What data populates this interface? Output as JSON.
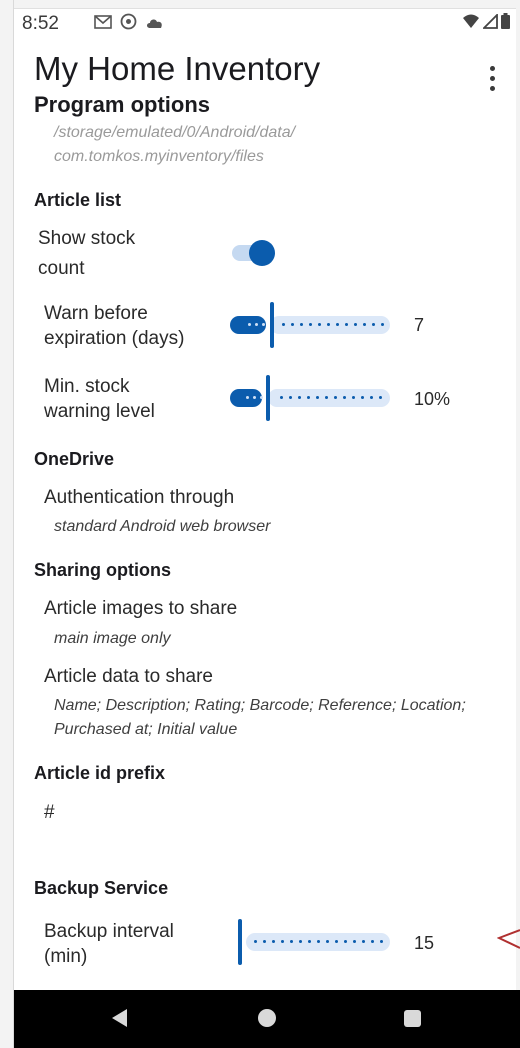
{
  "status_bar": {
    "time": "8:52",
    "left_icons": [
      "gmail-icon",
      "sync-icon",
      "cloud-icon"
    ],
    "right_icons": [
      "wifi-icon",
      "signal-icon",
      "battery-icon"
    ]
  },
  "app_bar": {
    "title": "My Home Inventory",
    "menu_icon": "overflow-menu-icon"
  },
  "program_options": {
    "heading": "Program options",
    "path_line1": "/storage/emulated/0/Android/data/",
    "path_line2": "com.tomkos.myinventory/files"
  },
  "article_list": {
    "heading": "Article list",
    "show_stock": {
      "label_line1": "Show stock",
      "label_line2": "count",
      "checked": true
    },
    "warn_expiration": {
      "label_line1": "Warn before",
      "label_line2": "expiration (days)",
      "value": "7"
    },
    "min_stock": {
      "label_line1": "Min. stock",
      "label_line2": "warning level",
      "value": "10%"
    }
  },
  "onedrive": {
    "heading": "OneDrive",
    "auth_title": "Authentication through",
    "auth_value": "standard Android web browser"
  },
  "sharing": {
    "heading": "Sharing options",
    "images_title": "Article images to share",
    "images_value": "main image only",
    "data_title": "Article data to share",
    "data_value_line1": "Name; Description; Rating; Barcode; Reference; Location;",
    "data_value_line2": "Purchased at; Initial value"
  },
  "article_id": {
    "heading": "Article id prefix",
    "value": "#"
  },
  "backup": {
    "heading": "Backup Service",
    "interval_label_line1": "Backup interval",
    "interval_label_line2": "(min)",
    "interval_value": "15"
  },
  "colors": {
    "accent": "#0b5cad",
    "track": "#dce8f8",
    "nav_bar": "#000000"
  }
}
